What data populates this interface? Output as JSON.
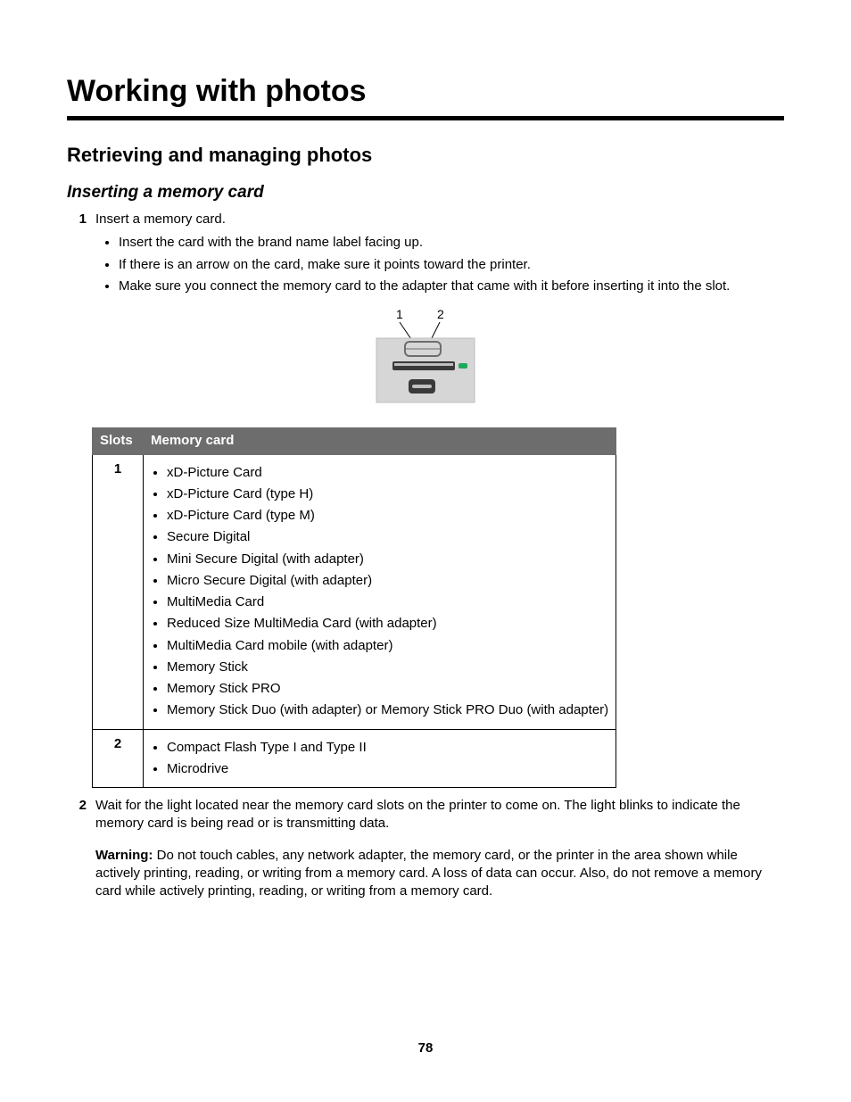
{
  "page_number": "78",
  "chapter_title": "Working with photos",
  "section_title": "Retrieving and managing photos",
  "subsection_title": "Inserting a memory card",
  "steps": [
    {
      "num": "1",
      "text": "Insert a memory card.",
      "bullets": [
        "Insert the card with the brand name label facing up.",
        "If there is an arrow on the card, make sure it points toward the printer.",
        "Make sure you connect the memory card to the adapter that came with it before inserting it into the slot."
      ]
    },
    {
      "num": "2",
      "text": "Wait for the light located near the memory card slots on the printer to come on. The light blinks to indicate the memory card is being read or is transmitting data."
    }
  ],
  "figure_labels": {
    "left": "1",
    "right": "2"
  },
  "table": {
    "headers": {
      "slots": "Slots",
      "card": "Memory card"
    },
    "rows": [
      {
        "slot": "1",
        "items": [
          "xD-Picture Card",
          "xD-Picture Card (type H)",
          "xD-Picture Card (type M)",
          "Secure Digital",
          "Mini Secure Digital (with adapter)",
          "Micro Secure Digital (with adapter)",
          "MultiMedia Card",
          "Reduced Size MultiMedia Card (with adapter)",
          "MultiMedia Card mobile (with adapter)",
          "Memory Stick",
          "Memory Stick PRO",
          "Memory Stick Duo (with adapter) or Memory Stick PRO Duo (with adapter)"
        ]
      },
      {
        "slot": "2",
        "items": [
          "Compact Flash Type I and Type II",
          "Microdrive"
        ]
      }
    ]
  },
  "warning": {
    "label": "Warning:",
    "text": "Do not touch cables, any network adapter, the memory card, or the printer in the area shown while actively printing, reading, or writing from a memory card. A loss of data can occur. Also, do not remove a memory card while actively printing, reading, or writing from a memory card."
  }
}
